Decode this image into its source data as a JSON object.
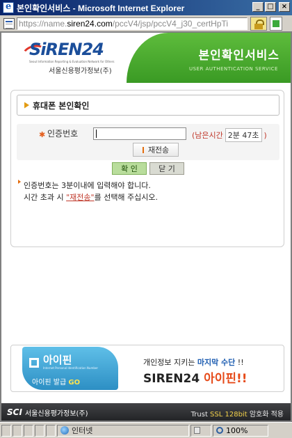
{
  "window": {
    "title": "본인확인서비스 - Microsoft Internet Explorer",
    "buttons": {
      "minimize": "_",
      "maximize": "□",
      "close": "×"
    }
  },
  "address": {
    "url_prefix": "https://name.",
    "url_domain": "siren24.com",
    "url_rest": "/pccV4/jsp/pccV4_j30_certHpTi"
  },
  "header": {
    "logo_text": "SiREN24",
    "logo_tagline": "Seoul Information Reporting & Evaluation Network for Others",
    "company": "서울신용평가정보(주)",
    "service_title": "본인확인서비스",
    "service_subtitle": "USER AUTHENTICATION SERVICE"
  },
  "section": {
    "title": "휴대폰 본인확인"
  },
  "form": {
    "code_label": "인증번호",
    "code_value": "",
    "remaining_label_open": "(남은시간",
    "timer": "2분 47초",
    "remaining_label_close": ")",
    "resend_label": "재전송",
    "confirm_label": "확 인",
    "cancel_label": "닫 기"
  },
  "notes": {
    "line1": "인증번호는 3분이내에 입력해야 합니다.",
    "line2_before": "시간 초과 시 ",
    "line2_link": "\"재전송\"",
    "line2_after": "를 선택해 주십시오."
  },
  "banner": {
    "ipin_name": "아이핀",
    "ipin_tagline": "Internet Personal Identification Number",
    "ipin_issue_prefix": "아이핀 발급 ",
    "ipin_issue_go": "GO",
    "msg1_before": "개인정보 지키는 ",
    "msg1_emph": "마지막 수단",
    "msg1_after": " !!",
    "msg2_brand": "SIREN24 ",
    "msg2_emph": "아이핀!!"
  },
  "footer": {
    "logo": "SCI",
    "company": "서울신용평가정보(주)",
    "ssl_prefix": "Trust ",
    "ssl_emph": "SSL 128bit",
    "ssl_suffix": " 암호화 적용"
  },
  "statusbar": {
    "zone": "인터넷",
    "zoom": "100%"
  },
  "colors": {
    "brand_green": "#4aa92e",
    "brand_blue": "#1b4e9a",
    "accent_red": "#c0392b"
  }
}
